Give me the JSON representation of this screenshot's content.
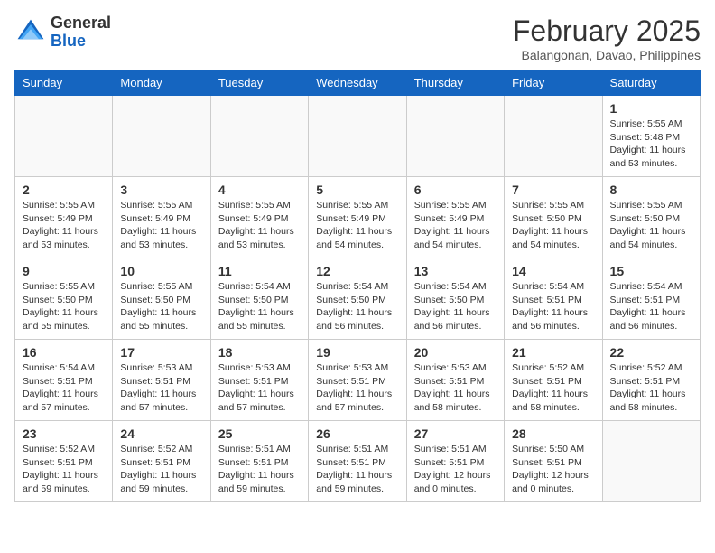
{
  "header": {
    "logo_line1": "General",
    "logo_line2": "Blue",
    "month": "February 2025",
    "location": "Balangonan, Davao, Philippines"
  },
  "days_of_week": [
    "Sunday",
    "Monday",
    "Tuesday",
    "Wednesday",
    "Thursday",
    "Friday",
    "Saturday"
  ],
  "weeks": [
    [
      {
        "day": "",
        "info": ""
      },
      {
        "day": "",
        "info": ""
      },
      {
        "day": "",
        "info": ""
      },
      {
        "day": "",
        "info": ""
      },
      {
        "day": "",
        "info": ""
      },
      {
        "day": "",
        "info": ""
      },
      {
        "day": "1",
        "info": "Sunrise: 5:55 AM\nSunset: 5:48 PM\nDaylight: 11 hours\nand 53 minutes."
      }
    ],
    [
      {
        "day": "2",
        "info": "Sunrise: 5:55 AM\nSunset: 5:49 PM\nDaylight: 11 hours\nand 53 minutes."
      },
      {
        "day": "3",
        "info": "Sunrise: 5:55 AM\nSunset: 5:49 PM\nDaylight: 11 hours\nand 53 minutes."
      },
      {
        "day": "4",
        "info": "Sunrise: 5:55 AM\nSunset: 5:49 PM\nDaylight: 11 hours\nand 53 minutes."
      },
      {
        "day": "5",
        "info": "Sunrise: 5:55 AM\nSunset: 5:49 PM\nDaylight: 11 hours\nand 54 minutes."
      },
      {
        "day": "6",
        "info": "Sunrise: 5:55 AM\nSunset: 5:49 PM\nDaylight: 11 hours\nand 54 minutes."
      },
      {
        "day": "7",
        "info": "Sunrise: 5:55 AM\nSunset: 5:50 PM\nDaylight: 11 hours\nand 54 minutes."
      },
      {
        "day": "8",
        "info": "Sunrise: 5:55 AM\nSunset: 5:50 PM\nDaylight: 11 hours\nand 54 minutes."
      }
    ],
    [
      {
        "day": "9",
        "info": "Sunrise: 5:55 AM\nSunset: 5:50 PM\nDaylight: 11 hours\nand 55 minutes."
      },
      {
        "day": "10",
        "info": "Sunrise: 5:55 AM\nSunset: 5:50 PM\nDaylight: 11 hours\nand 55 minutes."
      },
      {
        "day": "11",
        "info": "Sunrise: 5:54 AM\nSunset: 5:50 PM\nDaylight: 11 hours\nand 55 minutes."
      },
      {
        "day": "12",
        "info": "Sunrise: 5:54 AM\nSunset: 5:50 PM\nDaylight: 11 hours\nand 56 minutes."
      },
      {
        "day": "13",
        "info": "Sunrise: 5:54 AM\nSunset: 5:50 PM\nDaylight: 11 hours\nand 56 minutes."
      },
      {
        "day": "14",
        "info": "Sunrise: 5:54 AM\nSunset: 5:51 PM\nDaylight: 11 hours\nand 56 minutes."
      },
      {
        "day": "15",
        "info": "Sunrise: 5:54 AM\nSunset: 5:51 PM\nDaylight: 11 hours\nand 56 minutes."
      }
    ],
    [
      {
        "day": "16",
        "info": "Sunrise: 5:54 AM\nSunset: 5:51 PM\nDaylight: 11 hours\nand 57 minutes."
      },
      {
        "day": "17",
        "info": "Sunrise: 5:53 AM\nSunset: 5:51 PM\nDaylight: 11 hours\nand 57 minutes."
      },
      {
        "day": "18",
        "info": "Sunrise: 5:53 AM\nSunset: 5:51 PM\nDaylight: 11 hours\nand 57 minutes."
      },
      {
        "day": "19",
        "info": "Sunrise: 5:53 AM\nSunset: 5:51 PM\nDaylight: 11 hours\nand 57 minutes."
      },
      {
        "day": "20",
        "info": "Sunrise: 5:53 AM\nSunset: 5:51 PM\nDaylight: 11 hours\nand 58 minutes."
      },
      {
        "day": "21",
        "info": "Sunrise: 5:52 AM\nSunset: 5:51 PM\nDaylight: 11 hours\nand 58 minutes."
      },
      {
        "day": "22",
        "info": "Sunrise: 5:52 AM\nSunset: 5:51 PM\nDaylight: 11 hours\nand 58 minutes."
      }
    ],
    [
      {
        "day": "23",
        "info": "Sunrise: 5:52 AM\nSunset: 5:51 PM\nDaylight: 11 hours\nand 59 minutes."
      },
      {
        "day": "24",
        "info": "Sunrise: 5:52 AM\nSunset: 5:51 PM\nDaylight: 11 hours\nand 59 minutes."
      },
      {
        "day": "25",
        "info": "Sunrise: 5:51 AM\nSunset: 5:51 PM\nDaylight: 11 hours\nand 59 minutes."
      },
      {
        "day": "26",
        "info": "Sunrise: 5:51 AM\nSunset: 5:51 PM\nDaylight: 11 hours\nand 59 minutes."
      },
      {
        "day": "27",
        "info": "Sunrise: 5:51 AM\nSunset: 5:51 PM\nDaylight: 12 hours\nand 0 minutes."
      },
      {
        "day": "28",
        "info": "Sunrise: 5:50 AM\nSunset: 5:51 PM\nDaylight: 12 hours\nand 0 minutes."
      },
      {
        "day": "",
        "info": ""
      }
    ]
  ]
}
